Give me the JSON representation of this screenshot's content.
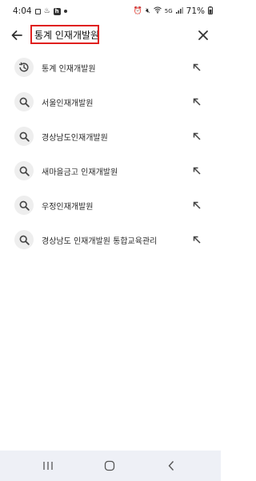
{
  "status_bar": {
    "time": "4:04",
    "battery": "71%"
  },
  "search": {
    "query": "통계 인재개발원"
  },
  "suggestions": [
    {
      "text": "통계 인재개발원",
      "icon": "history-icon"
    },
    {
      "text": "서울인재개발원",
      "icon": "search-icon"
    },
    {
      "text": "경상남도인재개발원",
      "icon": "search-icon"
    },
    {
      "text": "새마을금고 인재개발원",
      "icon": "search-icon"
    },
    {
      "text": "우정인재개발원",
      "icon": "search-icon"
    },
    {
      "text": "경상남도 인재개발원 통합교육관리",
      "icon": "search-icon"
    }
  ]
}
